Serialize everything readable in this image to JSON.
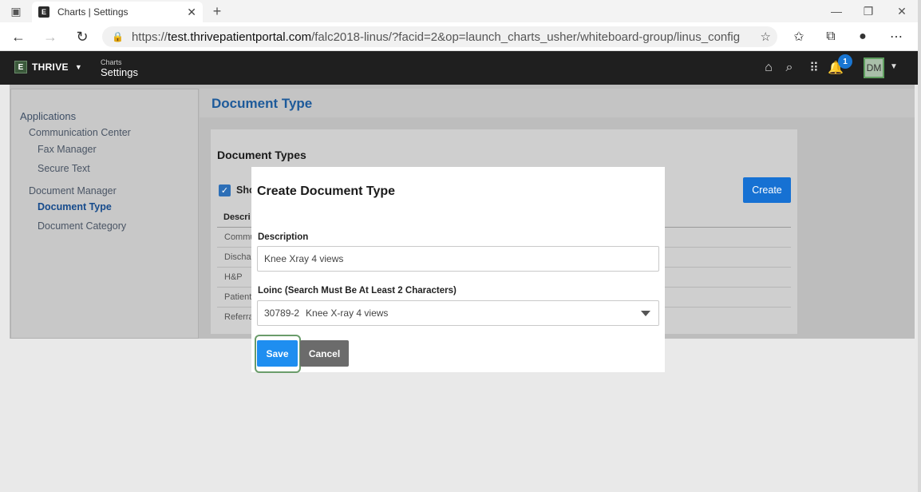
{
  "browser": {
    "tab_title": "Charts | Settings",
    "tab_close": "✕",
    "new_tab": "+",
    "url_domain": "test.thrivepatientportal.com",
    "url_prefix": "https://",
    "url_path": "/falc2018-linus/?facid=2&op=launch_charts_usher/whiteboard-group/linus_config"
  },
  "app": {
    "brand_logo": "E",
    "brand_name": "THRIVE",
    "crumb_small": "Charts",
    "crumb_big": "Settings",
    "notification_count": "1",
    "avatar_initials": "DM"
  },
  "sidebar": {
    "section": "Applications",
    "groups": [
      {
        "label": "Communication Center",
        "items": [
          "Fax Manager",
          "Secure Text"
        ]
      },
      {
        "label": "Document Manager",
        "items": [
          "Document Type",
          "Document Category"
        ]
      }
    ]
  },
  "main": {
    "page_title": "Document Type",
    "card_title": "Document Types",
    "show_label": "Sho",
    "create_label": "Create",
    "table_header": "Descri",
    "rows": [
      "Commu",
      "Dischar",
      "H&P",
      "Patient",
      "Referra"
    ]
  },
  "modal": {
    "title": "Create Document Type",
    "description_label": "Description",
    "description_placeholder": "Knee Xray 4 views",
    "loinc_label": "Loinc (Search Must Be At Least 2 Characters)",
    "loinc_code": "30789-2",
    "loinc_name": "Knee X-ray 4 views",
    "save_label": "Save",
    "cancel_label": "Cancel"
  }
}
